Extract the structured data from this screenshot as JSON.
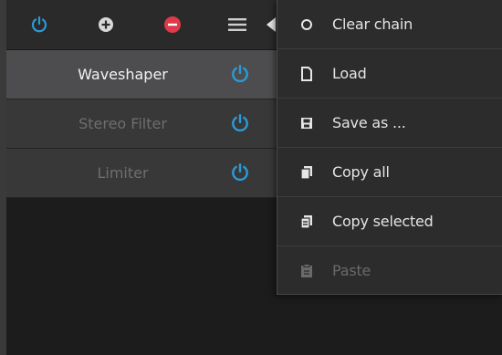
{
  "toolbar": {
    "power_icon": "power-icon",
    "add_icon": "plus-circle-icon",
    "remove_icon": "minus-circle-icon",
    "menu_icon": "hamburger-menu-icon",
    "colors": {
      "power": "#2a9ad8",
      "add": "#d8d8d8",
      "remove": "#e0394a"
    }
  },
  "chain": {
    "items": [
      {
        "label": "Waveshaper",
        "state": "selected",
        "power_icon": "power-icon"
      },
      {
        "label": "Stereo Filter",
        "state": "inactive",
        "power_icon": "power-icon"
      },
      {
        "label": "Limiter",
        "state": "inactive",
        "power_icon": "power-icon"
      }
    ]
  },
  "menu": {
    "items": [
      {
        "label": "Clear chain",
        "icon": "circle-icon",
        "enabled": true
      },
      {
        "label": "Load",
        "icon": "file-icon",
        "enabled": true
      },
      {
        "label": "Save as ...",
        "icon": "save-icon",
        "enabled": true
      },
      {
        "label": "Copy all",
        "icon": "copy-all-icon",
        "enabled": true
      },
      {
        "label": "Copy selected",
        "icon": "copy-selected-icon",
        "enabled": true
      },
      {
        "label": "Paste",
        "icon": "paste-icon",
        "enabled": false
      }
    ]
  }
}
